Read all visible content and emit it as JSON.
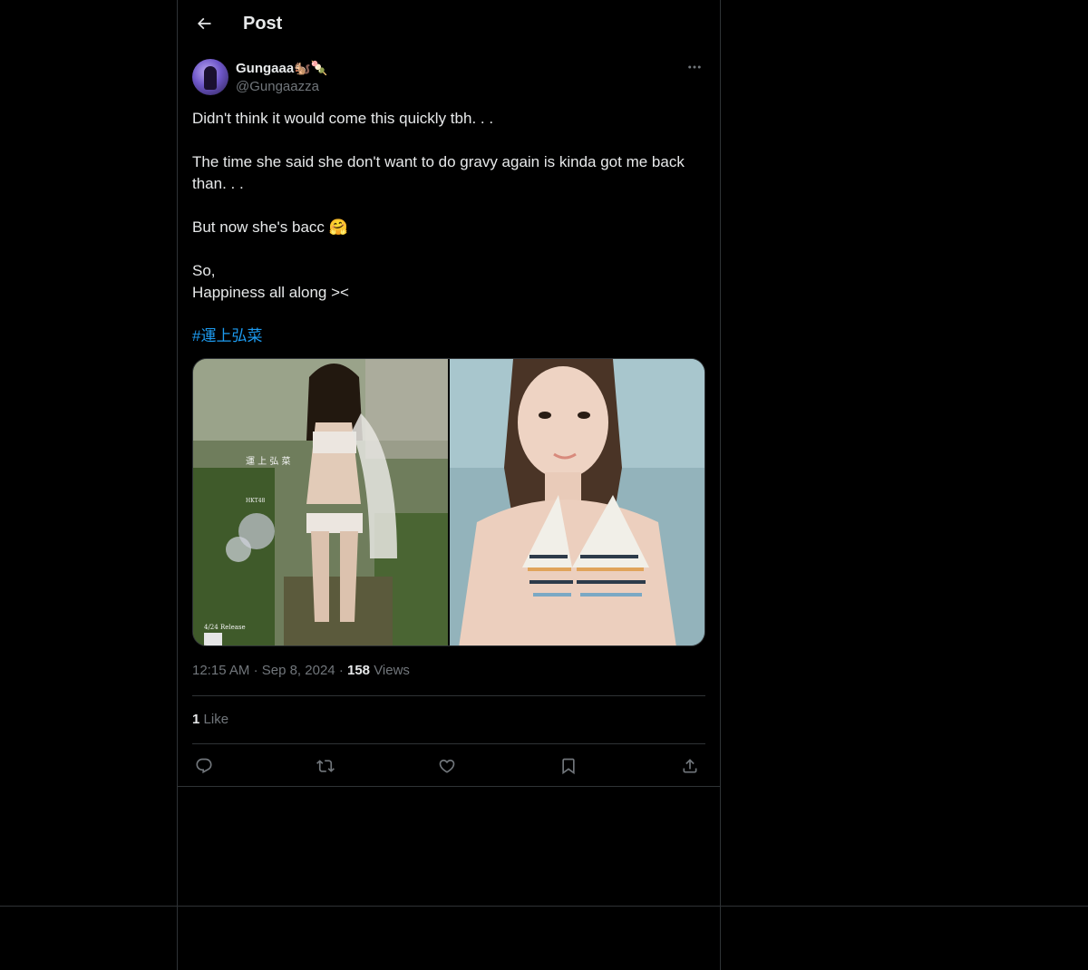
{
  "header": {
    "title": "Post"
  },
  "author": {
    "display_name": "Gungaaa🐿️🍡",
    "handle": "@Gungaazza"
  },
  "tweet": {
    "line1": "Didn't think it would come this quickly tbh. . .",
    "line2": "The time she said she don't want to do gravy again is kinda got me back than. . .",
    "line3": "But now she's bacc 🤗",
    "line4": "So,",
    "line5": "Happiness all along ><",
    "hashtag": "#運上弘菜"
  },
  "media": {
    "left_caption_name": "運 上 弘 菜",
    "left_caption_group": "HKT48",
    "left_release": "4/24 Release"
  },
  "meta": {
    "time": "12:15 AM",
    "date": "Sep 8, 2024",
    "views_count": "158",
    "views_label": "Views",
    "separator": "·"
  },
  "engagement": {
    "likes_count": "1",
    "likes_label": "Like"
  },
  "actions": {
    "reply_icon": "reply-icon",
    "repost_icon": "repost-icon",
    "like_icon": "heart-icon",
    "bookmark_icon": "bookmark-icon",
    "share_icon": "share-icon"
  },
  "colors": {
    "background": "#000000",
    "text": "#e7e9ea",
    "muted": "#71767b",
    "border": "#2f3336",
    "accent": "#1d9bf0"
  }
}
